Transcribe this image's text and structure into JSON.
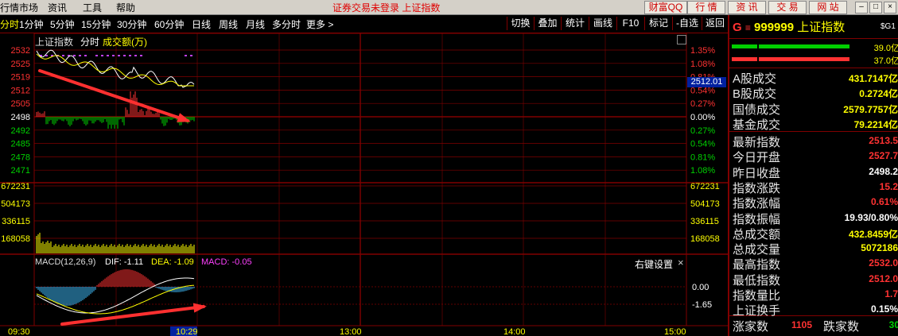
{
  "menubar": {
    "items": [
      "行情市场",
      "资讯",
      "工具",
      "帮助"
    ],
    "status": "证券交易未登录 上证指数",
    "buttons": [
      "财富QQ",
      "行 情",
      "资 讯",
      "交 易",
      "网 站"
    ]
  },
  "toolbar": {
    "periods": [
      "分时",
      "1分钟",
      "5分钟",
      "15分钟",
      "30分钟",
      "60分钟",
      "日线",
      "周线",
      "月线",
      "多分时",
      "更多 >"
    ],
    "active_period": "分时",
    "tools": [
      "切换",
      "叠加",
      "统计",
      "画线",
      "F10",
      "标记",
      "-自选",
      "返回"
    ]
  },
  "chart": {
    "title": "上证指数",
    "mode": "分时",
    "volume_label": "成交额(万)",
    "price_ticks_left": [
      "2532",
      "2525",
      "2519",
      "2512",
      "2505",
      "2498",
      "2492",
      "2485",
      "2478",
      "2471"
    ],
    "pct_ticks_right": [
      "1.35%",
      "1.08%",
      "0.81%",
      "0.54%",
      "0.27%",
      "0.00%",
      "0.27%",
      "0.54%",
      "0.81%",
      "1.08%"
    ],
    "current_price_tag": "2512.01",
    "volume_ticks": [
      "672231",
      "504173",
      "336115",
      "168058"
    ],
    "macd": {
      "label": "MACD(12,26,9)",
      "dif": "DIF: -1.11",
      "dea": "DEA: -1.09",
      "macd": "MACD: -0.05",
      "settings": "右键设置",
      "close": "×",
      "ticks": [
        "0.00",
        "-1.65"
      ]
    },
    "time_axis": [
      "09:30",
      "10:29",
      "13:00",
      "14:00",
      "15:00"
    ],
    "colors": {
      "up": "#ff3232",
      "down": "#00d000",
      "grid": "#800000",
      "price_line": "#ffffff",
      "avg_line": "#ffff00",
      "arrow": "#ff3030"
    }
  },
  "panel": {
    "symbol_prefix": "G",
    "symbol_code": "999999",
    "symbol_name": "上证指数",
    "badge": "$G1",
    "bar_values": [
      "39.0亿",
      "37.0亿"
    ],
    "rows_a": [
      {
        "label": "A股成交",
        "value": "431.7147亿"
      },
      {
        "label": "B股成交",
        "value": "0.2724亿"
      },
      {
        "label": "国债成交",
        "value": "2579.7757亿"
      },
      {
        "label": "基金成交",
        "value": "79.2214亿"
      }
    ],
    "rows_b": [
      {
        "label": "最新指数",
        "value": "2513.5",
        "color": "#ff3232"
      },
      {
        "label": "今日开盘",
        "value": "2527.7",
        "color": "#ff3232"
      },
      {
        "label": "昨日收盘",
        "value": "2498.2",
        "color": "#ffffff"
      },
      {
        "label": "指数涨跌",
        "value": "15.2",
        "color": "#ff3232"
      },
      {
        "label": "指数涨幅",
        "value": "0.61%",
        "color": "#ff3232"
      },
      {
        "label": "指数振幅",
        "value": "19.93/0.80%",
        "color": "#ffffff"
      },
      {
        "label": "总成交额",
        "value": "432.8459亿",
        "color": "#ffff00"
      },
      {
        "label": "总成交量",
        "value": "5072186",
        "color": "#ffff00"
      },
      {
        "label": "最高指数",
        "value": "2532.0",
        "color": "#ff3232"
      },
      {
        "label": "最低指数",
        "value": "2512.0",
        "color": "#ff3232"
      },
      {
        "label": "指数量比",
        "value": "1.7",
        "color": "#ff3232"
      },
      {
        "label": "上证换手",
        "value": "0.15%",
        "color": "#ffffff"
      }
    ],
    "footer": {
      "up_label": "涨家数",
      "up_value": "1105",
      "down_label": "跌家数",
      "down_value": "30"
    }
  }
}
